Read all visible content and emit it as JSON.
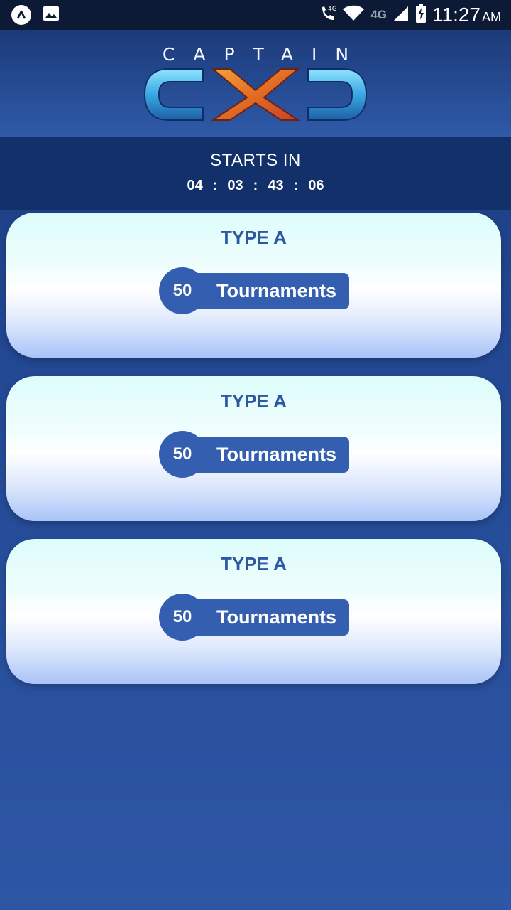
{
  "status_bar": {
    "network_label": "4G",
    "network_label_2": "4G",
    "time": "11:27",
    "ampm": "AM"
  },
  "header": {
    "brand_word": "CAPTAIN",
    "logo_text": "CXD"
  },
  "countdown": {
    "label": "STARTS IN",
    "days": "04",
    "hours": "03",
    "minutes": "43",
    "seconds": "06",
    "separator": ":"
  },
  "cards": [
    {
      "title": "TYPE A",
      "count": "50",
      "label": "Tournaments"
    },
    {
      "title": "TYPE A",
      "count": "50",
      "label": "Tournaments"
    },
    {
      "title": "TYPE A",
      "count": "50",
      "label": "Tournaments"
    }
  ],
  "colors": {
    "background": "#2d56a4",
    "status_bar": "#0c1a36",
    "card_title": "#2f58a3",
    "pill": "#345fb0",
    "logo_blue": "#4bb8ef",
    "logo_orange": "#e5792a"
  },
  "icons": {
    "app": "app-launcher-icon",
    "gallery": "image-icon",
    "call": "wifi-call-icon",
    "wifi": "wifi-icon",
    "signal": "signal-icon",
    "battery": "battery-charging-icon"
  }
}
